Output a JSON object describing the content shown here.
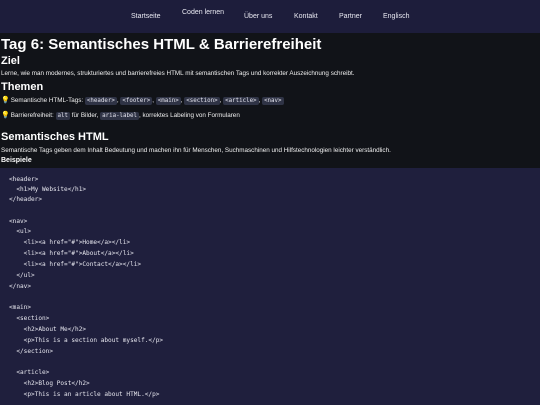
{
  "nav": {
    "items": [
      "Startseite",
      "Coden lernen",
      "Über uns",
      "Kontakt",
      "Partner",
      "Englisch"
    ]
  },
  "page": {
    "title": "Tag 6: Semantisches HTML & Barrierefreiheit",
    "goal_heading": "Ziel",
    "goal_text": "Lerne, wie man modernes, strukturiertes und barrierefreies HTML mit semantischen Tags und korrekter Auszeichnung schreibt.",
    "topics_heading": "Themen",
    "topic1_label": "Semantische HTML-Tags:",
    "topic1_tags": [
      "<header>",
      "<footer>",
      "<main>",
      "<section>",
      "<article>",
      "<nav>"
    ],
    "topic2_label": "Barrierefreiheit:",
    "topic2_code1": "alt",
    "topic2_text1": "für Bilder,",
    "topic2_code2": "aria-label",
    "topic2_text2": ", korrektes Labeling von Formularen",
    "semantic_heading": "Semantisches HTML",
    "semantic_text": "Semantische Tags geben dem Inhalt Bedeutung und machen ihn für Menschen, Suchmaschinen und Hilfstechnologien leichter verständlich.",
    "examples_heading": "Beispiele"
  },
  "code": {
    "lines": [
      "<header>",
      "  <h1>My Website</h1>",
      "</header>",
      "",
      "<nav>",
      "  <ul>",
      "    <li><a href=\"#\">Home</a></li>",
      "    <li><a href=\"#\">About</a></li>",
      "    <li><a href=\"#\">Contact</a></li>",
      "  </ul>",
      "</nav>",
      "",
      "<main>",
      "  <section>",
      "    <h2>About Me</h2>",
      "    <p>This is a section about myself.</p>",
      "  </section>",
      "",
      "  <article>",
      "    <h2>Blog Post</h2>",
      "    <p>This is an article about HTML.</p>"
    ]
  }
}
